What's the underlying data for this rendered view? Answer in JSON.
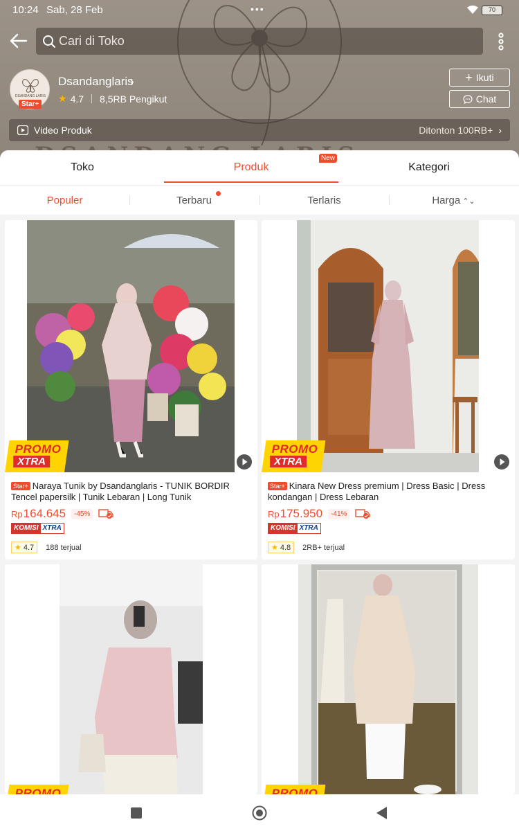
{
  "status_bar": {
    "time": "10:24",
    "date": "Sab, 28 Feb",
    "dots": "•••",
    "battery": "70"
  },
  "header": {
    "search_placeholder": "Cari di Toko",
    "shop_name": "Dsandanglaris",
    "shop_logo_text": "DSANDANG LARIS",
    "star_badge": "Star+",
    "rating": "4.7",
    "followers": "8,5RB Pengikut",
    "follow_label": "Ikuti",
    "chat_label": "Chat",
    "video_label": "Video Produk",
    "video_views": "Ditonton 100RB+"
  },
  "tabs": [
    {
      "label": "Toko",
      "active": false
    },
    {
      "label": "Produk",
      "active": true
    },
    {
      "label": "Kategori",
      "active": false
    }
  ],
  "new_badge": "New",
  "sort": [
    {
      "label": "Populer",
      "active": true
    },
    {
      "label": "Terbaru",
      "active": false
    },
    {
      "label": "Terlaris",
      "active": false
    },
    {
      "label": "Harga",
      "active": false
    }
  ],
  "promo": {
    "line1": "PROMO",
    "line2": "XTRA"
  },
  "products": [
    {
      "badge": "Star+",
      "title": "Naraya Tunik by Dsandanglaris - TUNIK BORDIR Tencel papersilk | Tunik Lebaran | Long Tunik",
      "currency": "Rp",
      "price": "164.645",
      "discount": "-45%",
      "komisi": [
        "KOMISI",
        "XTRA"
      ],
      "rating": "4.7",
      "sold": "188 terjual"
    },
    {
      "badge": "Star+",
      "title": "Kinara New Dress premium | Dress Basic | Dress kondangan | Dress Lebaran",
      "currency": "Rp",
      "price": "175.950",
      "discount": "-41%",
      "komisi": [
        "KOMISI",
        "XTRA"
      ],
      "rating": "4.8",
      "sold": "2RB+ terjual"
    }
  ],
  "colors": {
    "accent": "#ee4d2d",
    "promo_yellow": "#ffd400"
  }
}
